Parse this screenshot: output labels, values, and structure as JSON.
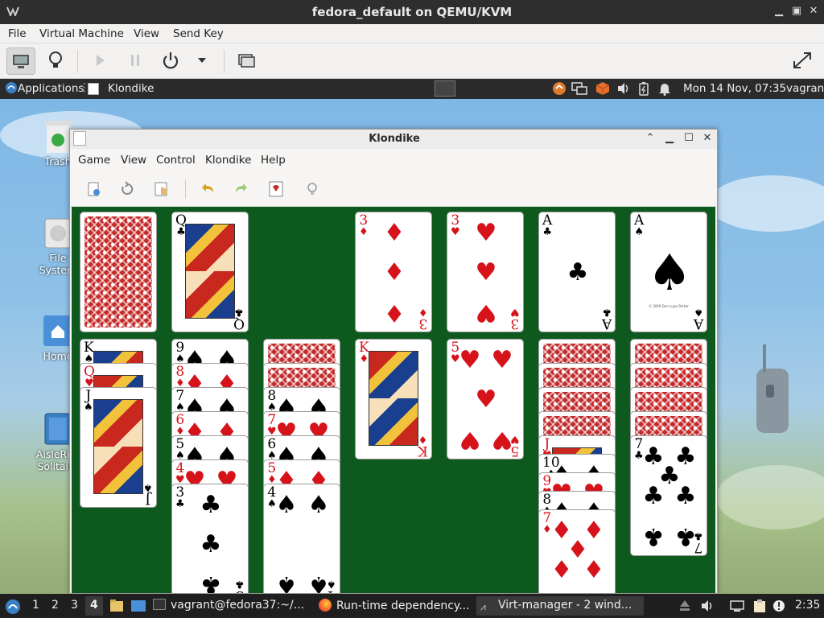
{
  "host": {
    "title": "fedora_default on QEMU/KVM",
    "menu": [
      "File",
      "Virtual Machine",
      "View",
      "Send Key"
    ],
    "toolbar_icons": [
      "monitor-icon",
      "lightbulb-icon",
      "play-icon",
      "pause-icon",
      "power-icon",
      "chevron-down-icon",
      "snapshots-icon",
      "fullscreen-icon"
    ]
  },
  "guest_top_panel": {
    "applications": "Applications",
    "active_window": "Klondike",
    "clock": "Mon 14 Nov, 07:35",
    "user": "vagrant"
  },
  "desktop_icons": [
    {
      "label": "Trash"
    },
    {
      "label": "File System"
    },
    {
      "label": "Home"
    },
    {
      "label": "AisleRiot Solitaire"
    }
  ],
  "klondike": {
    "title": "Klondike",
    "menu": [
      "Game",
      "View",
      "Control",
      "Klondike",
      "Help"
    ],
    "toolbar_icons": [
      "new-game-icon",
      "restart-icon",
      "start-icon",
      "undo-icon",
      "redo-icon",
      "deal-icon",
      "hint-icon"
    ]
  },
  "cards": {
    "waste": {
      "rank": "Q",
      "suit": "♣"
    },
    "foundations": [
      {
        "rank": "3",
        "suit": "♦"
      },
      {
        "rank": "3",
        "suit": "♥"
      },
      {
        "rank": "A",
        "suit": "♣"
      },
      {
        "rank": "A",
        "suit": "♠"
      }
    ],
    "ace_fineprint": "© 2009 Dan Lupo-Parker",
    "tableau": [
      [
        {
          "rank": "K",
          "suit": "♠"
        },
        {
          "rank": "Q",
          "suit": "♥"
        },
        {
          "rank": "J",
          "suit": "♠"
        }
      ],
      [
        {
          "rank": "9",
          "suit": "♠"
        },
        {
          "rank": "8",
          "suit": "♦"
        },
        {
          "rank": "7",
          "suit": "♠"
        },
        {
          "rank": "6",
          "suit": "♦"
        },
        {
          "rank": "5",
          "suit": "♠"
        },
        {
          "rank": "4",
          "suit": "♥"
        },
        {
          "rank": "3",
          "suit": "♣"
        }
      ],
      [
        {
          "rank": "8",
          "suit": "♠"
        },
        {
          "rank": "7",
          "suit": "♥"
        },
        {
          "rank": "6",
          "suit": "♠"
        },
        {
          "rank": "5",
          "suit": "♦"
        },
        {
          "rank": "4",
          "suit": "♠"
        }
      ],
      [
        {
          "rank": "K",
          "suit": "♦"
        }
      ],
      [
        {
          "rank": "5",
          "suit": "♥"
        }
      ],
      [
        {
          "rank": "J",
          "suit": "♥"
        },
        {
          "rank": "10",
          "suit": "♠"
        },
        {
          "rank": "9",
          "suit": "♥"
        },
        {
          "rank": "8",
          "suit": "♠"
        },
        {
          "rank": "7",
          "suit": "♦"
        }
      ],
      [
        {
          "rank": "7",
          "suit": "♣"
        }
      ]
    ]
  },
  "guest_bottom_panel": {
    "workspaces": [
      "1",
      "2",
      "3",
      "4"
    ],
    "tasks": [
      "vagrant@fedora37:~/...",
      "Run-time dependency...",
      "Virt-manager - 2 wind..."
    ],
    "clock": "2:35"
  },
  "colors": {
    "felt": "#0e5a1e",
    "red_suit": "#d6131b",
    "card_back": "#c42a2a",
    "panel": "#2b2b2b"
  }
}
